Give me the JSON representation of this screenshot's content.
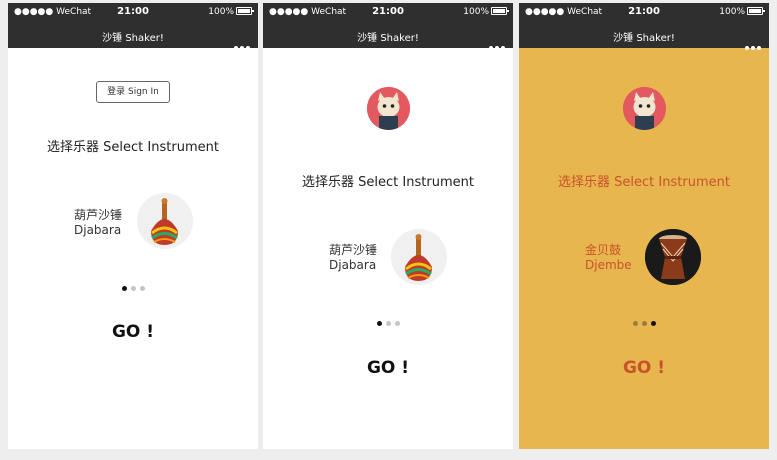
{
  "statusbar": {
    "signal": "●●●●● WeChat",
    "time": "21:00",
    "battery": "100%"
  },
  "navbar": {
    "title": "沙锤 Shaker!"
  },
  "phone1": {
    "signin_label": "登录 Sign In",
    "select_title": "选择乐器 Select Instrument",
    "instrument_cn": "葫芦沙锤",
    "instrument_en": "Djabara",
    "go_label": "GO !"
  },
  "phone2": {
    "select_title": "选择乐器 Select Instrument",
    "instrument_cn": "葫芦沙锤",
    "instrument_en": "Djabara",
    "go_label": "GO !"
  },
  "phone3": {
    "select_title": "选择乐器 Select Instrument",
    "instrument_cn": "金贝鼓",
    "instrument_en": "Djembe",
    "go_label": "GO !"
  },
  "colors": {
    "bar": "#2f2f2f",
    "accent_bg": "#e8b64f",
    "accent_text": "#c8532a"
  },
  "icons": [
    "more-icon",
    "wifi-icon",
    "battery-icon",
    "user-avatar",
    "djabara-shaker-image",
    "djembe-drum-image"
  ]
}
